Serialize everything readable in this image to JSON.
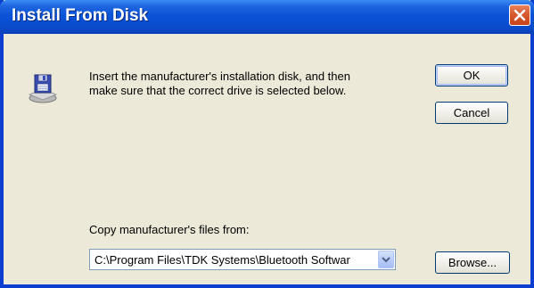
{
  "window": {
    "title": "Install From Disk"
  },
  "message": {
    "line1": "Insert the manufacturer's installation disk, and then",
    "line2": "make sure that the correct drive is selected below."
  },
  "buttons": {
    "ok": "OK",
    "cancel": "Cancel",
    "browse": "Browse..."
  },
  "copy_from": {
    "label": "Copy manufacturer's files from:",
    "value": "C:\\Program Files\\TDK Systems\\Bluetooth Softwar"
  },
  "icons": {
    "close": "close-icon",
    "disk": "floppy-disk-drive-icon",
    "dropdown": "chevron-down-icon"
  },
  "colors": {
    "titlebar": "#0a53d8",
    "window_bg": "#ece9d8",
    "close_button": "#d85a30",
    "button_border": "#003c74"
  }
}
